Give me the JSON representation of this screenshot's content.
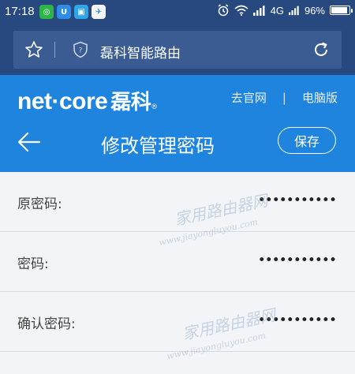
{
  "status_bar": {
    "time": "17:18",
    "apps": [
      {
        "icon": "app-icon-green",
        "color": "#2fb44a",
        "glyph": "◎"
      },
      {
        "icon": "app-icon-blue",
        "color": "#2e8be6",
        "glyph": "U"
      },
      {
        "icon": "app-icon-scan",
        "color": "#2fa4e6",
        "glyph": "▣"
      },
      {
        "icon": "app-icon-travel",
        "color": "#f4f4f4",
        "glyph": "✈"
      }
    ],
    "network": "4G",
    "battery": "96%",
    "battery_level": 0.96
  },
  "browser": {
    "url_title": "磊科智能路由"
  },
  "header": {
    "logo_text": "net·core",
    "logo_cn": "磊科",
    "links": [
      "去官网",
      "电脑版"
    ],
    "separator": "|",
    "page_title": "修改管理密码",
    "save_label": "保存"
  },
  "form": {
    "rows": [
      {
        "label": "原密码:",
        "value": "•••••••••••"
      },
      {
        "label": "密码:",
        "value": "•••••••••••"
      },
      {
        "label": "确认密码:",
        "value": "•••••••••••"
      }
    ]
  },
  "watermark": {
    "cn": "家用路由器网",
    "url": "www.jiayongluyou.com"
  },
  "colors": {
    "status_bar": "#27497f",
    "header": "#1f84dd",
    "form_bg": "#f2f4f7"
  }
}
